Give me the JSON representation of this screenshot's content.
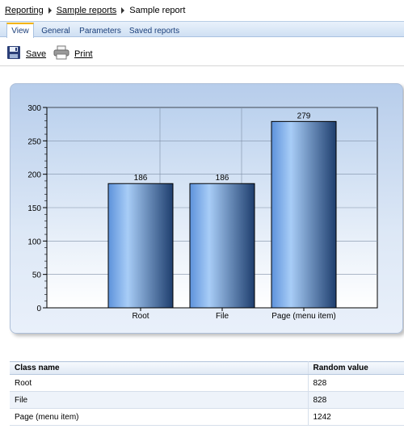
{
  "breadcrumb": {
    "items": [
      "Reporting",
      "Sample reports",
      "Sample report"
    ]
  },
  "tabs": [
    "View",
    "General",
    "Parameters",
    "Saved reports"
  ],
  "active_tab": "View",
  "toolbar": {
    "save_label": "Save",
    "print_label": "Print"
  },
  "chart_data": {
    "type": "bar",
    "categories": [
      "Root",
      "File",
      "Page (menu item)"
    ],
    "values": [
      186,
      186,
      279
    ],
    "ylim": [
      0,
      300
    ],
    "yticks": [
      0,
      50,
      100,
      150,
      200,
      250,
      300
    ],
    "grid": true,
    "colors": {
      "bar_light": "#a8cdf7",
      "bar_dark": "#1e3e6e",
      "bar_mid": "#5d92db"
    }
  },
  "table": {
    "columns": [
      "Class name",
      "Random value"
    ],
    "rows": [
      [
        "Root",
        "828"
      ],
      [
        "File",
        "828"
      ],
      [
        "Page (menu item)",
        "1242"
      ]
    ]
  }
}
